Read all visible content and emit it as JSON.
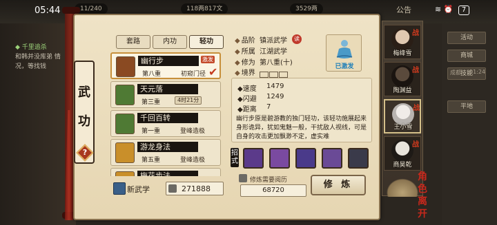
{
  "status_bar": {
    "time": "05:44",
    "notice": "公告",
    "battery": "7"
  },
  "top_bar": {
    "res1": "11/240",
    "res2": "118两817文",
    "res3": "3529两"
  },
  "quest": {
    "title": "◆ 千里追杀",
    "text": "和韩并没库弟 情况，等找钱"
  },
  "right_menu": {
    "btn1": "活动",
    "btn2": "商城",
    "btn3": "技能",
    "label1": "成都",
    "label2": "01:24",
    "btn4": "平地"
  },
  "title_plaque": {
    "char1": "武",
    "char2": "功",
    "help": "?"
  },
  "tabs": [
    {
      "label": "套路",
      "active": false
    },
    {
      "label": "内功",
      "active": false
    },
    {
      "label": "轻功",
      "active": true
    }
  ],
  "skills": [
    {
      "name": "幽行步",
      "level": "第八重",
      "stage": "初窥门径",
      "tag": "激发",
      "selected": true,
      "icon_color": "#8a4a22"
    },
    {
      "name": "天元落",
      "level": "第三重",
      "timer": "4时21分",
      "selected": false,
      "icon_color": "#4f7a34"
    },
    {
      "name": "千回百转",
      "level": "第一重",
      "stage": "登峰造极",
      "selected": false,
      "icon_color": "#4f7a34"
    },
    {
      "name": "游龙身法",
      "level": "第五重",
      "stage": "登峰造极",
      "selected": false,
      "icon_color": "#c98f2a"
    },
    {
      "name": "梅花步法",
      "level": "",
      "stage": "",
      "selected": false,
      "icon_color": "#c98f2a"
    }
  ],
  "new_skill": {
    "label": "新武学",
    "exp": "271888"
  },
  "detail": {
    "grade_label": "品阶",
    "grade_value": "镇派武学",
    "sect_badge": "读",
    "faction_label": "所属",
    "faction_value": "江湖武学",
    "cultivation_label": "修为",
    "cultivation_value": "第八重(十)",
    "realm_label": "境界",
    "portrait_label": "已激发"
  },
  "stats": {
    "speed_label": "速度",
    "speed_value": "1479",
    "dodge_label": "闪避",
    "dodge_value": "1249",
    "distance_label": "距离",
    "distance_value": "7",
    "description": "幽行步原是碧游教的独门轻功，该轻功施展起来身形诡异，犹如鬼魅一般，干扰敌人视线，可是自身的攻击更加飘渺不定，虚实难"
  },
  "moves": {
    "label": "招式",
    "slots": [
      "#5b3a8a",
      "#7a4aa0",
      "#4a3a8a",
      "#6a4a96",
      "#3a3a4a"
    ]
  },
  "practice": {
    "label": "修炼需要阅历",
    "cost": "68720",
    "button": "修 炼"
  },
  "characters": [
    {
      "name": "梅绛雪",
      "face": "#e0c8b0"
    },
    {
      "name": "陶渊益",
      "face": "#3a3028"
    },
    {
      "name": "王小雪",
      "face": "#dcd8d4"
    },
    {
      "name": "商昊乾",
      "face": "#d8d4cc"
    }
  ],
  "char_tab": {
    "top": "角色",
    "bottom": "离开"
  },
  "colors": {
    "accent_red": "#c43a1e",
    "parchment": "#efe3c6",
    "dark_ink": "#1a1510"
  }
}
